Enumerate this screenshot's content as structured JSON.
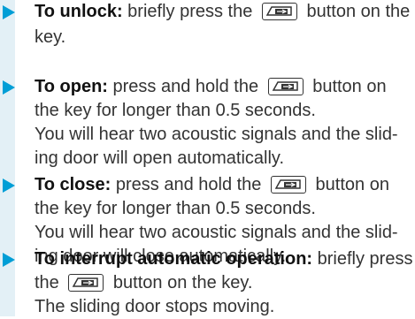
{
  "items": [
    {
      "lead": "To unlock:",
      "line1": " briefly press the",
      "line1_after": " button on the",
      "line2": "key."
    },
    {
      "lead": "To open:",
      "line1": " press and hold the",
      "line1_after": " button on",
      "line2": "the key for longer than 0.5 seconds.",
      "line3": "You will hear two acoustic signals and the slid-",
      "line4": "ing door will open automatically."
    },
    {
      "lead": "To close:",
      "line1": " press and hold the",
      "line1_after": " button on",
      "line2": "the key for longer than 0.5 seconds.",
      "line3": "You will hear two acoustic signals and the slid-",
      "line4": "ing door will close automatically."
    },
    {
      "lead": "To interrupt automatic operation:",
      "line1": " briefly press",
      "line2_before": "the",
      "line2_after": " button on the key.",
      "line3": "The sliding door stops moving."
    }
  ],
  "icons": {
    "bullet": "triangle-bullet-icon",
    "key_button": "sliding-door-key-button-icon"
  },
  "colors": {
    "accent_bar": "#e3f0f6",
    "bullet": "#009ed6",
    "text": "#333333",
    "lead_text": "#111111"
  }
}
